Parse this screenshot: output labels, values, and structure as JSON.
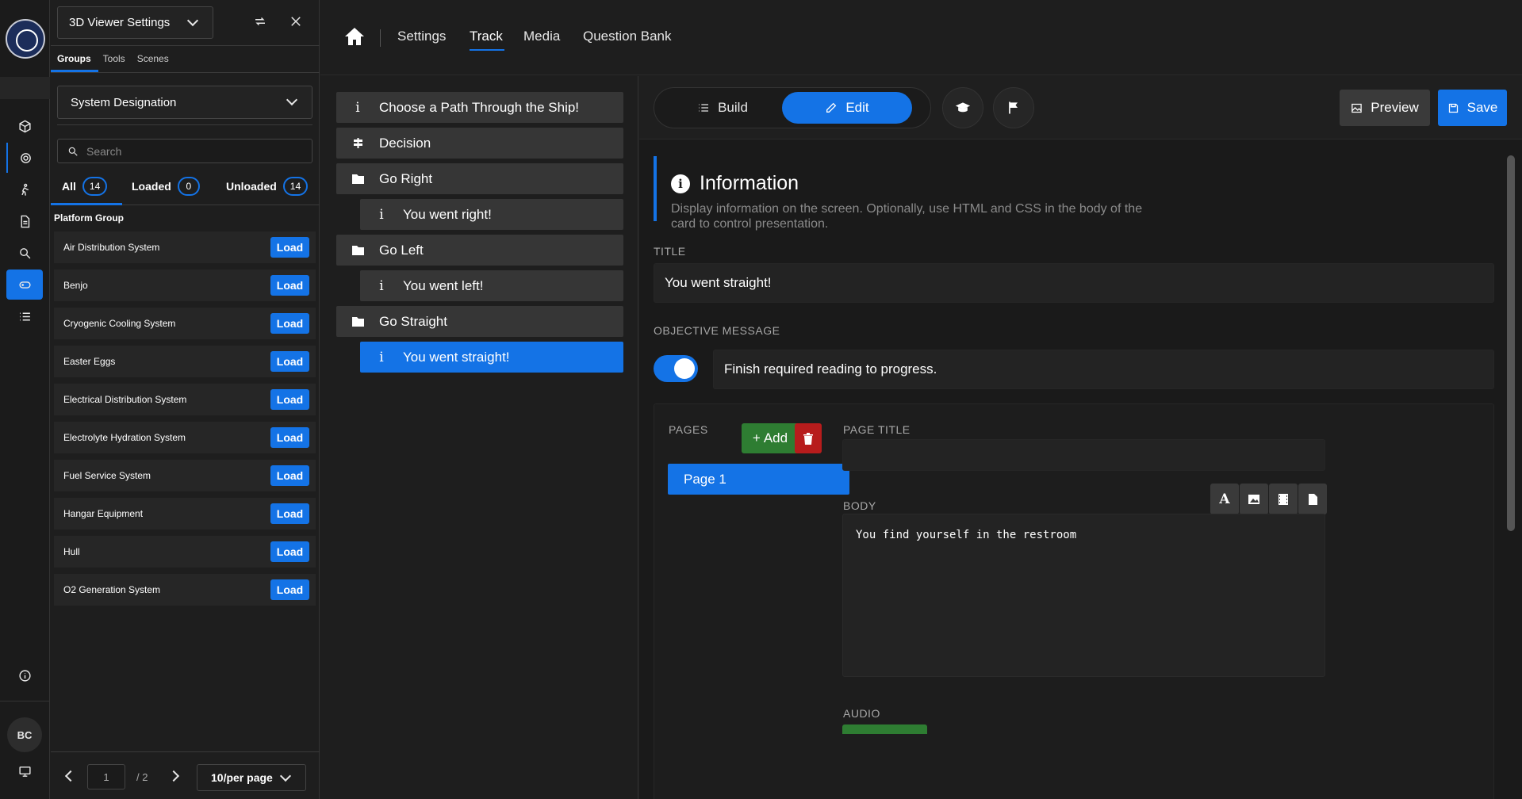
{
  "rail": {
    "avatar_initials": "BC"
  },
  "viewer_panel": {
    "title": "3D Viewer Settings",
    "tabs": [
      "Groups",
      "Tools",
      "Scenes"
    ],
    "group_select": "System Designation",
    "search_placeholder": "Search",
    "filters": [
      {
        "label": "All",
        "count": "14"
      },
      {
        "label": "Loaded",
        "count": "0"
      },
      {
        "label": "Unloaded",
        "count": "14"
      }
    ],
    "group_title": "Platform Group",
    "systems": [
      "Air Distribution System",
      "Benjo",
      "Cryogenic Cooling System",
      "Easter Eggs",
      "Electrical Distribution System",
      "Electrolyte Hydration System",
      "Fuel Service System",
      "Hangar Equipment",
      "Hull",
      "O2 Generation System"
    ],
    "load_label": "Load",
    "pager": {
      "page": "1",
      "total": "/ 2",
      "per_page": "10/per page"
    }
  },
  "topnav": {
    "links": [
      "Settings",
      "Track",
      "Media",
      "Question Bank"
    ],
    "active": "Track"
  },
  "tree": [
    {
      "label": "Choose a Path Through the Ship!",
      "icon": "info-icon",
      "level": 0
    },
    {
      "label": "Decision",
      "icon": "signpost-icon",
      "level": 0
    },
    {
      "label": "Go Right",
      "icon": "folder-icon",
      "level": 0
    },
    {
      "label": "You went right!",
      "icon": "info-icon",
      "level": 1
    },
    {
      "label": "Go Left",
      "icon": "folder-icon",
      "level": 0
    },
    {
      "label": "You went left!",
      "icon": "info-icon",
      "level": 1
    },
    {
      "label": "Go Straight",
      "icon": "folder-icon",
      "level": 0
    },
    {
      "label": "You went straight!",
      "icon": "info-icon",
      "level": 1,
      "selected": true
    }
  ],
  "editor": {
    "build_label": "Build",
    "edit_label": "Edit",
    "preview_label": "Preview",
    "save_label": "Save",
    "card_type": "Information",
    "card_description": "Display information on the screen. Optionally, use HTML and CSS in the body of the card to control presentation.",
    "title_label": "TITLE",
    "title_value": "You went straight!",
    "objective_label": "OBJECTIVE MESSAGE",
    "objective_enabled": true,
    "objective_value": "Finish required reading to progress.",
    "pages_label": "PAGES",
    "add_label": "Add",
    "pages": [
      "Page 1"
    ],
    "page_title_label": "PAGE TITLE",
    "page_title_value": "",
    "body_label": "BODY",
    "body_value": "You find yourself in the restroom",
    "audio_label": "AUDIO"
  },
  "colors": {
    "accent": "#1473e6",
    "success": "#2e7d32",
    "danger": "#b71c1c"
  }
}
